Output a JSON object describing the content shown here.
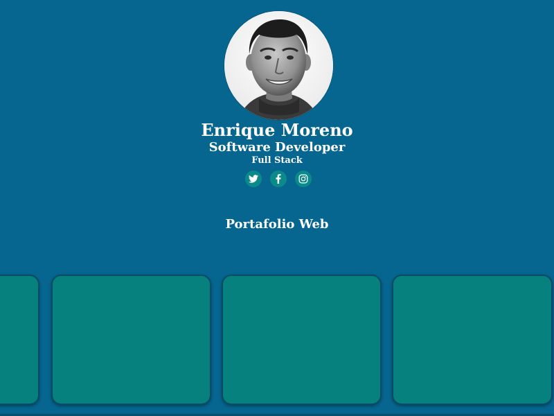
{
  "profile": {
    "name": "Enrique Moreno",
    "role": "Software Developer",
    "stack": "Full Stack",
    "avatar_alt": "profile photo"
  },
  "socials": [
    {
      "icon": "twitter-icon",
      "label": "Twitter"
    },
    {
      "icon": "facebook-icon",
      "label": "Facebook"
    },
    {
      "icon": "instagram-icon",
      "label": "Instagram"
    }
  ],
  "portfolio": {
    "title": "Portafolio Web",
    "cards": [
      {},
      {},
      {},
      {}
    ]
  },
  "colors": {
    "background": "#066690",
    "accent": "#06817d",
    "social_bg": "#0b8a8a",
    "text": "#ffffff"
  }
}
